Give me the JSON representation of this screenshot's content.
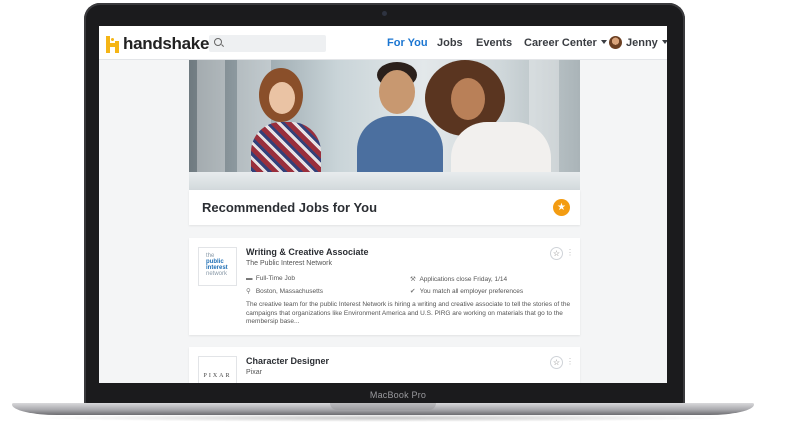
{
  "device": {
    "label": "MacBook Pro"
  },
  "app": {
    "brand": "handshake",
    "search": {
      "placeholder": ""
    },
    "nav": [
      {
        "label": "For You",
        "active": true
      },
      {
        "label": "Jobs"
      },
      {
        "label": "Events"
      },
      {
        "label": "Career Center"
      }
    ],
    "user": {
      "name": "Jenny"
    }
  },
  "recommendations": {
    "title": "Recommended Jobs for You",
    "badge_icon": "star-icon"
  },
  "jobs": [
    {
      "title": "Writing & Creative Associate",
      "company": "The Public Interest Network",
      "logo_lines": [
        "the",
        "public",
        "interest",
        "network"
      ],
      "job_type": "Full-Time Job",
      "location": "Boston, Massachusetts",
      "deadline": "Applications close Friday, 1/14",
      "match": "You match all employer preferences",
      "description": "The creative team for the public Interest Network is hiring a writing and creative associate to tell the stories of the campaigns that organizations like Environment America and U.S. PIRG are working on materials that go to the membersip base..."
    },
    {
      "title": "Character Designer",
      "company": "Pixar",
      "logo_text": "PIXAR"
    }
  ],
  "colors": {
    "brand_yellow": "#f5b516",
    "nav_active": "#1a75d1",
    "badge_orange": "#f39c12"
  }
}
